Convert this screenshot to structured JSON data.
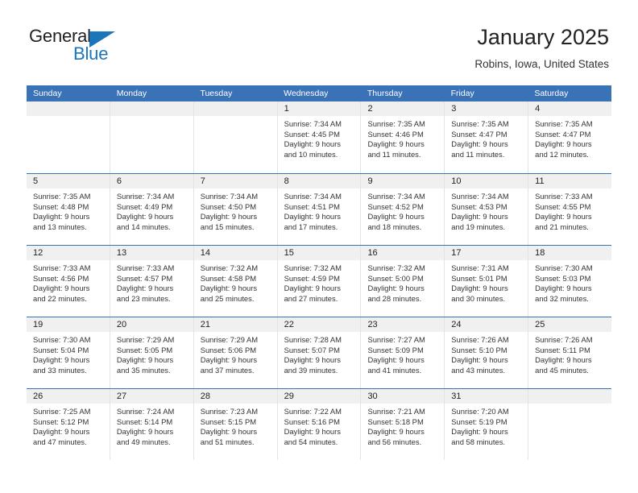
{
  "logo": {
    "word_one": "General",
    "word_two": "Blue",
    "triangle_icon": "triangle-icon",
    "brand_color": "#1b75bb"
  },
  "header": {
    "title": "January 2025",
    "subtitle": "Robins, Iowa, United States"
  },
  "theme": {
    "header_blue": "#3a72b8",
    "day_band_gray": "#f0f0f0",
    "text_color": "#333333"
  },
  "weekdays": [
    "Sunday",
    "Monday",
    "Tuesday",
    "Wednesday",
    "Thursday",
    "Friday",
    "Saturday"
  ],
  "weeks": [
    [
      {
        "day": "",
        "sunrise": "",
        "sunset": "",
        "daylight_line1": "",
        "daylight_line2": "",
        "empty": true
      },
      {
        "day": "",
        "sunrise": "",
        "sunset": "",
        "daylight_line1": "",
        "daylight_line2": "",
        "empty": true
      },
      {
        "day": "",
        "sunrise": "",
        "sunset": "",
        "daylight_line1": "",
        "daylight_line2": "",
        "empty": true
      },
      {
        "day": "1",
        "sunrise": "Sunrise: 7:34 AM",
        "sunset": "Sunset: 4:45 PM",
        "daylight_line1": "Daylight: 9 hours",
        "daylight_line2": "and 10 minutes."
      },
      {
        "day": "2",
        "sunrise": "Sunrise: 7:35 AM",
        "sunset": "Sunset: 4:46 PM",
        "daylight_line1": "Daylight: 9 hours",
        "daylight_line2": "and 11 minutes."
      },
      {
        "day": "3",
        "sunrise": "Sunrise: 7:35 AM",
        "sunset": "Sunset: 4:47 PM",
        "daylight_line1": "Daylight: 9 hours",
        "daylight_line2": "and 11 minutes."
      },
      {
        "day": "4",
        "sunrise": "Sunrise: 7:35 AM",
        "sunset": "Sunset: 4:47 PM",
        "daylight_line1": "Daylight: 9 hours",
        "daylight_line2": "and 12 minutes."
      }
    ],
    [
      {
        "day": "5",
        "sunrise": "Sunrise: 7:35 AM",
        "sunset": "Sunset: 4:48 PM",
        "daylight_line1": "Daylight: 9 hours",
        "daylight_line2": "and 13 minutes."
      },
      {
        "day": "6",
        "sunrise": "Sunrise: 7:34 AM",
        "sunset": "Sunset: 4:49 PM",
        "daylight_line1": "Daylight: 9 hours",
        "daylight_line2": "and 14 minutes."
      },
      {
        "day": "7",
        "sunrise": "Sunrise: 7:34 AM",
        "sunset": "Sunset: 4:50 PM",
        "daylight_line1": "Daylight: 9 hours",
        "daylight_line2": "and 15 minutes."
      },
      {
        "day": "8",
        "sunrise": "Sunrise: 7:34 AM",
        "sunset": "Sunset: 4:51 PM",
        "daylight_line1": "Daylight: 9 hours",
        "daylight_line2": "and 17 minutes."
      },
      {
        "day": "9",
        "sunrise": "Sunrise: 7:34 AM",
        "sunset": "Sunset: 4:52 PM",
        "daylight_line1": "Daylight: 9 hours",
        "daylight_line2": "and 18 minutes."
      },
      {
        "day": "10",
        "sunrise": "Sunrise: 7:34 AM",
        "sunset": "Sunset: 4:53 PM",
        "daylight_line1": "Daylight: 9 hours",
        "daylight_line2": "and 19 minutes."
      },
      {
        "day": "11",
        "sunrise": "Sunrise: 7:33 AM",
        "sunset": "Sunset: 4:55 PM",
        "daylight_line1": "Daylight: 9 hours",
        "daylight_line2": "and 21 minutes."
      }
    ],
    [
      {
        "day": "12",
        "sunrise": "Sunrise: 7:33 AM",
        "sunset": "Sunset: 4:56 PM",
        "daylight_line1": "Daylight: 9 hours",
        "daylight_line2": "and 22 minutes."
      },
      {
        "day": "13",
        "sunrise": "Sunrise: 7:33 AM",
        "sunset": "Sunset: 4:57 PM",
        "daylight_line1": "Daylight: 9 hours",
        "daylight_line2": "and 23 minutes."
      },
      {
        "day": "14",
        "sunrise": "Sunrise: 7:32 AM",
        "sunset": "Sunset: 4:58 PM",
        "daylight_line1": "Daylight: 9 hours",
        "daylight_line2": "and 25 minutes."
      },
      {
        "day": "15",
        "sunrise": "Sunrise: 7:32 AM",
        "sunset": "Sunset: 4:59 PM",
        "daylight_line1": "Daylight: 9 hours",
        "daylight_line2": "and 27 minutes."
      },
      {
        "day": "16",
        "sunrise": "Sunrise: 7:32 AM",
        "sunset": "Sunset: 5:00 PM",
        "daylight_line1": "Daylight: 9 hours",
        "daylight_line2": "and 28 minutes."
      },
      {
        "day": "17",
        "sunrise": "Sunrise: 7:31 AM",
        "sunset": "Sunset: 5:01 PM",
        "daylight_line1": "Daylight: 9 hours",
        "daylight_line2": "and 30 minutes."
      },
      {
        "day": "18",
        "sunrise": "Sunrise: 7:30 AM",
        "sunset": "Sunset: 5:03 PM",
        "daylight_line1": "Daylight: 9 hours",
        "daylight_line2": "and 32 minutes."
      }
    ],
    [
      {
        "day": "19",
        "sunrise": "Sunrise: 7:30 AM",
        "sunset": "Sunset: 5:04 PM",
        "daylight_line1": "Daylight: 9 hours",
        "daylight_line2": "and 33 minutes."
      },
      {
        "day": "20",
        "sunrise": "Sunrise: 7:29 AM",
        "sunset": "Sunset: 5:05 PM",
        "daylight_line1": "Daylight: 9 hours",
        "daylight_line2": "and 35 minutes."
      },
      {
        "day": "21",
        "sunrise": "Sunrise: 7:29 AM",
        "sunset": "Sunset: 5:06 PM",
        "daylight_line1": "Daylight: 9 hours",
        "daylight_line2": "and 37 minutes."
      },
      {
        "day": "22",
        "sunrise": "Sunrise: 7:28 AM",
        "sunset": "Sunset: 5:07 PM",
        "daylight_line1": "Daylight: 9 hours",
        "daylight_line2": "and 39 minutes."
      },
      {
        "day": "23",
        "sunrise": "Sunrise: 7:27 AM",
        "sunset": "Sunset: 5:09 PM",
        "daylight_line1": "Daylight: 9 hours",
        "daylight_line2": "and 41 minutes."
      },
      {
        "day": "24",
        "sunrise": "Sunrise: 7:26 AM",
        "sunset": "Sunset: 5:10 PM",
        "daylight_line1": "Daylight: 9 hours",
        "daylight_line2": "and 43 minutes."
      },
      {
        "day": "25",
        "sunrise": "Sunrise: 7:26 AM",
        "sunset": "Sunset: 5:11 PM",
        "daylight_line1": "Daylight: 9 hours",
        "daylight_line2": "and 45 minutes."
      }
    ],
    [
      {
        "day": "26",
        "sunrise": "Sunrise: 7:25 AM",
        "sunset": "Sunset: 5:12 PM",
        "daylight_line1": "Daylight: 9 hours",
        "daylight_line2": "and 47 minutes."
      },
      {
        "day": "27",
        "sunrise": "Sunrise: 7:24 AM",
        "sunset": "Sunset: 5:14 PM",
        "daylight_line1": "Daylight: 9 hours",
        "daylight_line2": "and 49 minutes."
      },
      {
        "day": "28",
        "sunrise": "Sunrise: 7:23 AM",
        "sunset": "Sunset: 5:15 PM",
        "daylight_line1": "Daylight: 9 hours",
        "daylight_line2": "and 51 minutes."
      },
      {
        "day": "29",
        "sunrise": "Sunrise: 7:22 AM",
        "sunset": "Sunset: 5:16 PM",
        "daylight_line1": "Daylight: 9 hours",
        "daylight_line2": "and 54 minutes."
      },
      {
        "day": "30",
        "sunrise": "Sunrise: 7:21 AM",
        "sunset": "Sunset: 5:18 PM",
        "daylight_line1": "Daylight: 9 hours",
        "daylight_line2": "and 56 minutes."
      },
      {
        "day": "31",
        "sunrise": "Sunrise: 7:20 AM",
        "sunset": "Sunset: 5:19 PM",
        "daylight_line1": "Daylight: 9 hours",
        "daylight_line2": "and 58 minutes."
      },
      {
        "day": "",
        "sunrise": "",
        "sunset": "",
        "daylight_line1": "",
        "daylight_line2": "",
        "empty": true
      }
    ]
  ]
}
